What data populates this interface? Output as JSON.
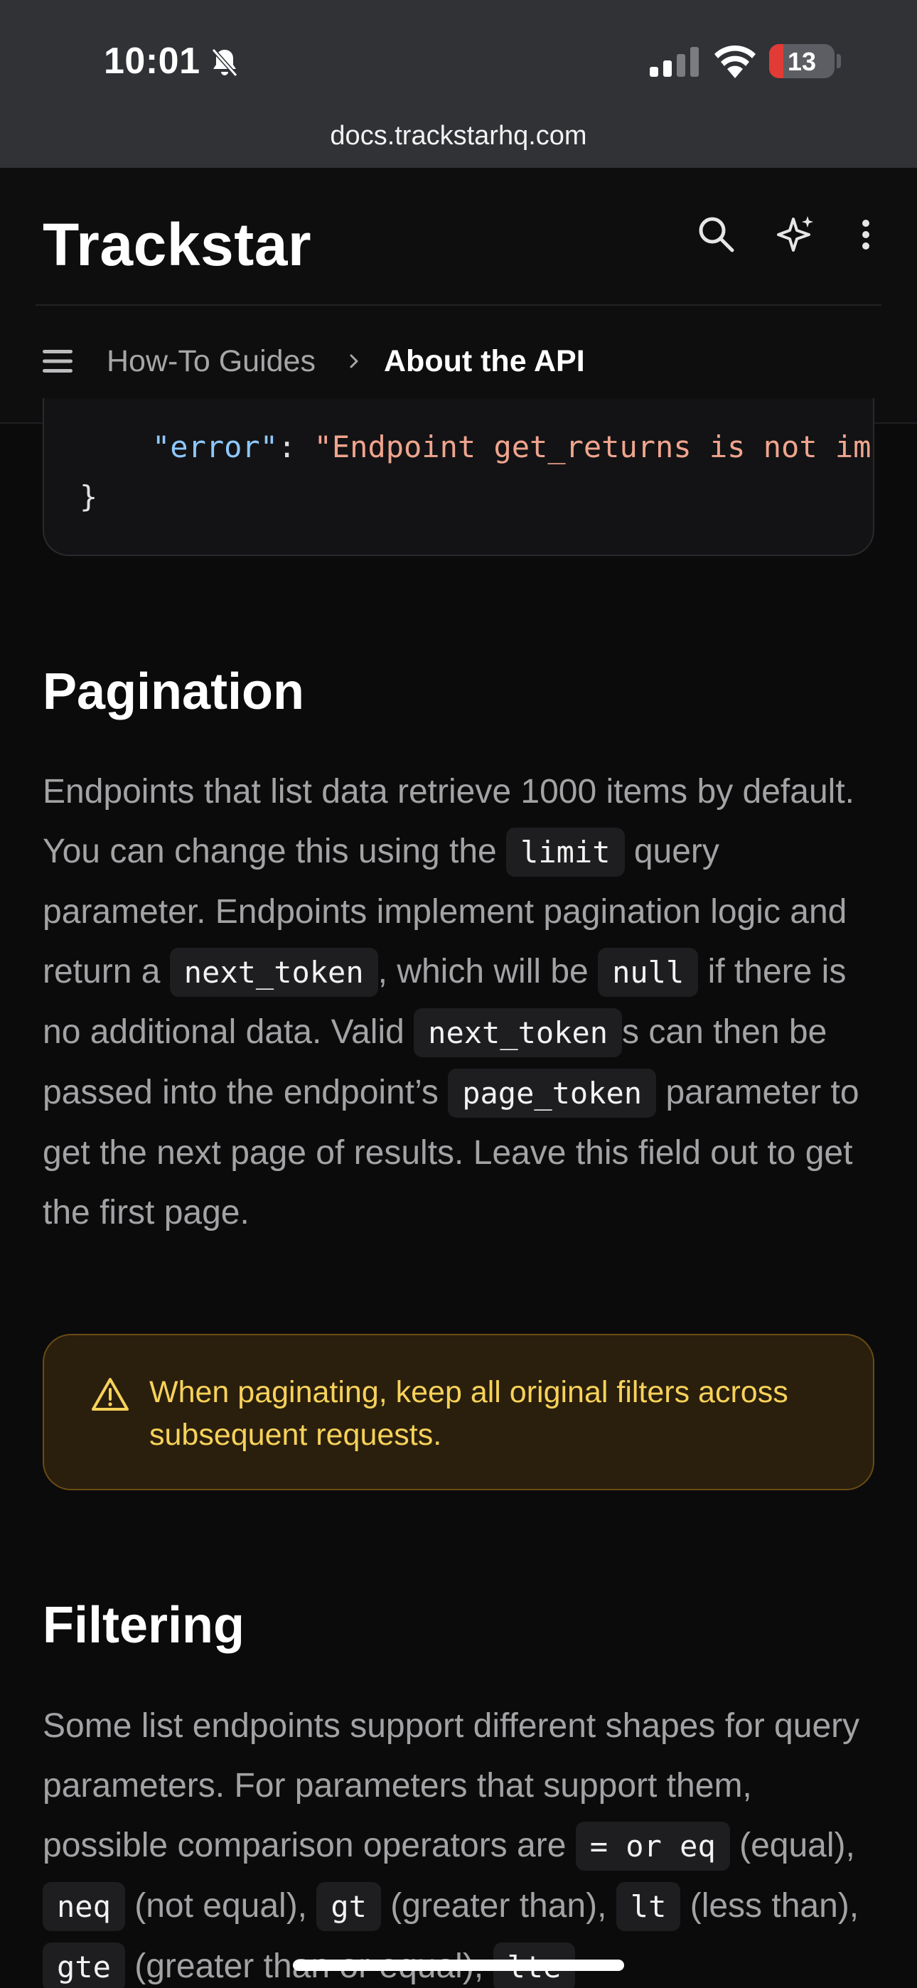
{
  "status_bar": {
    "time": "10:01",
    "battery": "13",
    "url": "docs.trackstarhq.com"
  },
  "header": {
    "brand": "Trackstar",
    "breadcrumb": [
      "How-To Guides",
      "About the API"
    ]
  },
  "code_fragment": {
    "line1_key": "\"error\"",
    "line1_colon": ": ",
    "line1_value": "\"Endpoint get_returns is not implemented\"",
    "line2": "}"
  },
  "pagination": {
    "heading": "Pagination",
    "p1": "Endpoints that list data retrieve 1000 items by default. You can change this using the",
    "code_limit": "limit",
    "p2": "query parameter. Endpoints implement pagination logic and return a",
    "code_next_token": "next_token",
    "p3": ", which will be",
    "code_null": "null",
    "p4": "if there is no additional data. Valid",
    "code_next_token_2": "next_token",
    "p5": "s can then be passed into the endpoint’s",
    "code_page_token": "page_token",
    "p6": "parameter to get the next page of results. Leave this field out to get the first page."
  },
  "warning": {
    "text": "When paginating, keep all original filters across subsequent requests."
  },
  "filtering": {
    "heading": "Filtering",
    "p1": "Some list endpoints support different shapes for query parameters. For parameters that support them, possible comparison operators are",
    "code_eq": "= or eq",
    "p2": "(equal),",
    "code_neq": "neq",
    "p3": "(not equal),",
    "code_gt": "gt",
    "p4": "(greater than),",
    "code_lt": "lt",
    "p5": "(less than),",
    "code_gte": "gte",
    "p6": "(greater than or equal),",
    "code_lte": "lte"
  },
  "colors": {
    "background": "#0b0b0c",
    "status_bar": "#303236",
    "warning_bg": "#2a1f0d",
    "warning_text": "#f7d25a",
    "battery_low": "#e23b35"
  },
  "icons": [
    "bell-slash-icon",
    "signal-icon",
    "wifi-icon",
    "battery-icon",
    "search-icon",
    "sparkle-icon",
    "more-vertical-icon",
    "menu-icon",
    "chevron-right-icon",
    "warning-triangle-icon"
  ]
}
